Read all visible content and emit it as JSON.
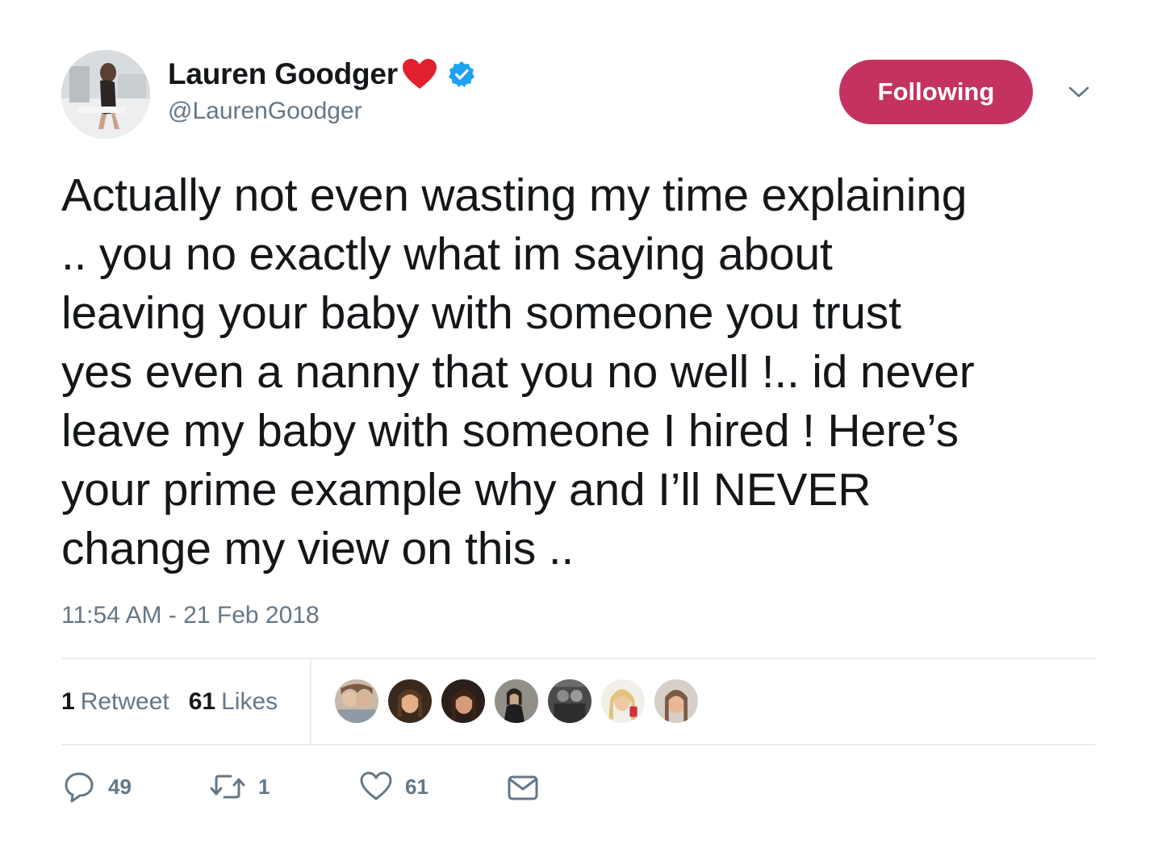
{
  "user": {
    "display_name": "Lauren Goodger",
    "handle": "@LaurenGoodger",
    "avatar_icon": "profile-photo",
    "name_emoji": "red-heart-icon",
    "verified": true
  },
  "follow_button": {
    "label": "Following",
    "color": "#c4335f"
  },
  "menu_icon": "chevron-down-icon",
  "tweet": {
    "text_lines": [
      "Actually not even wasting my time explaining",
      ".. you no exactly what im saying about",
      "leaving your baby with someone you trust",
      "yes even a nanny that you no well !.. id never",
      "leave my baby with someone I hired ! Here’s",
      "your prime example why and I’ll NEVER",
      "change my view on this .."
    ],
    "timestamp": "11:54 AM - 21 Feb 2018"
  },
  "stats": {
    "retweets_count": "1",
    "retweets_label": "Retweet",
    "likes_count": "61",
    "likes_label": "Likes"
  },
  "likers": [
    {
      "name": "liker-avatar-1"
    },
    {
      "name": "liker-avatar-2"
    },
    {
      "name": "liker-avatar-3"
    },
    {
      "name": "liker-avatar-4"
    },
    {
      "name": "liker-avatar-5"
    },
    {
      "name": "liker-avatar-6"
    },
    {
      "name": "liker-avatar-7"
    }
  ],
  "actions": {
    "reply": {
      "icon": "reply-icon",
      "count": "49"
    },
    "retweet": {
      "icon": "retweet-icon",
      "count": "1"
    },
    "like": {
      "icon": "heart-icon",
      "count": "61"
    },
    "message": {
      "icon": "envelope-icon"
    }
  },
  "colors": {
    "text": "#14171a",
    "secondary": "#657786",
    "divider": "#e6ecf0",
    "verified": "#1da1f2",
    "heart": "#e0245e"
  }
}
